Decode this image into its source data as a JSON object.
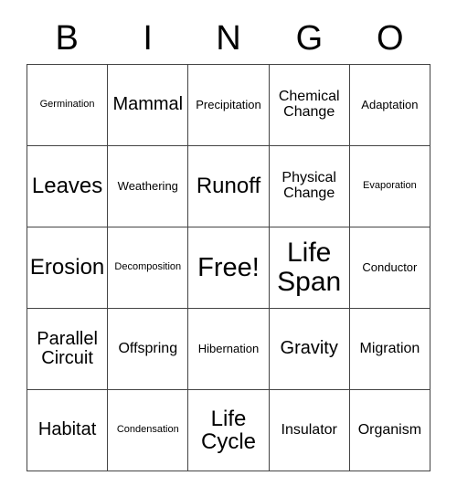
{
  "card": {
    "header_letters": [
      "B",
      "I",
      "N",
      "G",
      "O"
    ],
    "grid": {
      "rows": 5,
      "columns": 5,
      "border_color": "#444444",
      "background_color": "#ffffff",
      "text_color": "#000000"
    },
    "cells": [
      {
        "text": "Germination",
        "size": "xs",
        "free": false
      },
      {
        "text": "Mammal",
        "size": "lg",
        "free": false
      },
      {
        "text": "Precipitation",
        "size": "sm",
        "free": false
      },
      {
        "text": "Chemical Change",
        "size": "md",
        "free": false
      },
      {
        "text": "Adaptation",
        "size": "sm",
        "free": false
      },
      {
        "text": "Leaves",
        "size": "xl",
        "free": false
      },
      {
        "text": "Weathering",
        "size": "sm",
        "free": false
      },
      {
        "text": "Runoff",
        "size": "xl",
        "free": false
      },
      {
        "text": "Physical Change",
        "size": "md",
        "free": false
      },
      {
        "text": "Evaporation",
        "size": "xs",
        "free": false
      },
      {
        "text": "Erosion",
        "size": "xl",
        "free": false
      },
      {
        "text": "Decomposition",
        "size": "xs",
        "free": false
      },
      {
        "text": "Free!",
        "size": "free",
        "free": true
      },
      {
        "text": "Life Span",
        "size": "xxl",
        "free": false
      },
      {
        "text": "Conductor",
        "size": "sm",
        "free": false
      },
      {
        "text": "Parallel Circuit",
        "size": "lg",
        "free": false
      },
      {
        "text": "Offspring",
        "size": "md",
        "free": false
      },
      {
        "text": "Hibernation",
        "size": "sm",
        "free": false
      },
      {
        "text": "Gravity",
        "size": "lg",
        "free": false
      },
      {
        "text": "Migration",
        "size": "md",
        "free": false
      },
      {
        "text": "Habitat",
        "size": "lg",
        "free": false
      },
      {
        "text": "Condensation",
        "size": "xs",
        "free": false
      },
      {
        "text": "Life Cycle",
        "size": "xl",
        "free": false
      },
      {
        "text": "Insulator",
        "size": "md",
        "free": false
      },
      {
        "text": "Organism",
        "size": "md",
        "free": false
      }
    ]
  }
}
